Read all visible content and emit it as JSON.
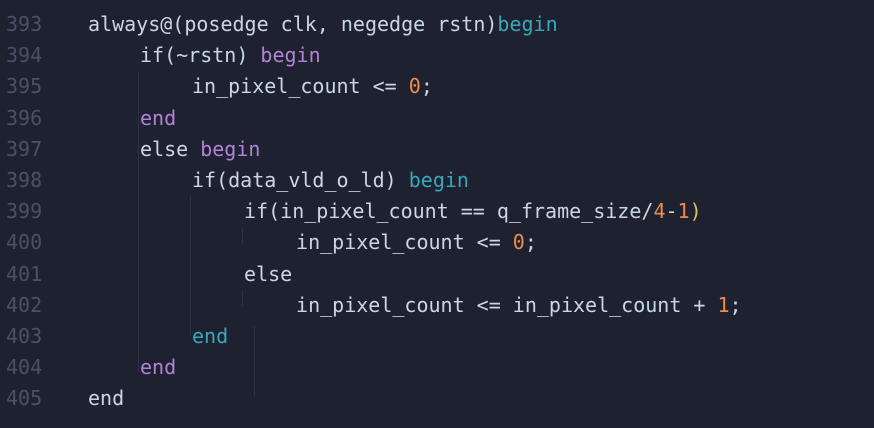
{
  "editor": {
    "lines": [
      {
        "number": "393",
        "tokens": [
          {
            "t": "always@(posedge clk, negedge rstn)",
            "c": "t-plain"
          },
          {
            "t": "begin",
            "c": "t-keyword-teal"
          }
        ]
      },
      {
        "number": "394",
        "tokens": [
          {
            "t": "if(",
            "c": "t-plain"
          },
          {
            "t": "~rstn",
            "c": "t-plain"
          },
          {
            "t": ")",
            "c": "t-plain"
          },
          {
            "t": " begin",
            "c": "t-keyword-purple"
          }
        ]
      },
      {
        "number": "395",
        "tokens": [
          {
            "t": "in_pixel_count <= ",
            "c": "t-plain"
          },
          {
            "t": "0",
            "c": "t-number"
          },
          {
            "t": ";",
            "c": "t-plain"
          }
        ]
      },
      {
        "number": "396",
        "tokens": [
          {
            "t": "end",
            "c": "t-keyword-purple"
          }
        ]
      },
      {
        "number": "397",
        "tokens": [
          {
            "t": "else ",
            "c": "t-plain"
          },
          {
            "t": "begin",
            "c": "t-keyword-purple"
          }
        ]
      },
      {
        "number": "398",
        "tokens": [
          {
            "t": "if(data_vld_o_ld) ",
            "c": "t-plain"
          },
          {
            "t": "begin",
            "c": "t-keyword-teal"
          }
        ]
      },
      {
        "number": "399",
        "tokens": [
          {
            "t": "if(in_pixel_count == q_frame_size/",
            "c": "t-plain"
          },
          {
            "t": "4",
            "c": "t-number"
          },
          {
            "t": "-",
            "c": "t-plain"
          },
          {
            "t": "1",
            "c": "t-number"
          },
          {
            "t": ")",
            "c": "t-paren"
          }
        ]
      },
      {
        "number": "400",
        "tokens": [
          {
            "t": "in_pixel_count <= ",
            "c": "t-plain"
          },
          {
            "t": "0",
            "c": "t-number"
          },
          {
            "t": ";",
            "c": "t-plain"
          }
        ]
      },
      {
        "number": "401",
        "tokens": [
          {
            "t": "else",
            "c": "t-plain"
          }
        ]
      },
      {
        "number": "402",
        "tokens": [
          {
            "t": "in_pixel_count <= in_pixel_count + ",
            "c": "t-plain"
          },
          {
            "t": "1",
            "c": "t-number"
          },
          {
            "t": ";",
            "c": "t-plain"
          }
        ]
      },
      {
        "number": "403",
        "tokens": [
          {
            "t": "end",
            "c": "t-keyword-teal"
          }
        ]
      },
      {
        "number": "404",
        "tokens": [
          {
            "t": "end",
            "c": "t-keyword-purple"
          }
        ]
      },
      {
        "number": "405",
        "tokens": [
          {
            "t": "end",
            "c": "t-plain"
          }
        ]
      }
    ]
  },
  "colors": {
    "background": "#1e2230",
    "line_number": "#4a5166",
    "plain": "#c9d6e3",
    "keyword_purple": "#b283d4",
    "keyword_teal": "#39a7b8",
    "number": "#f08a4b",
    "paren": "#d6c45a"
  }
}
